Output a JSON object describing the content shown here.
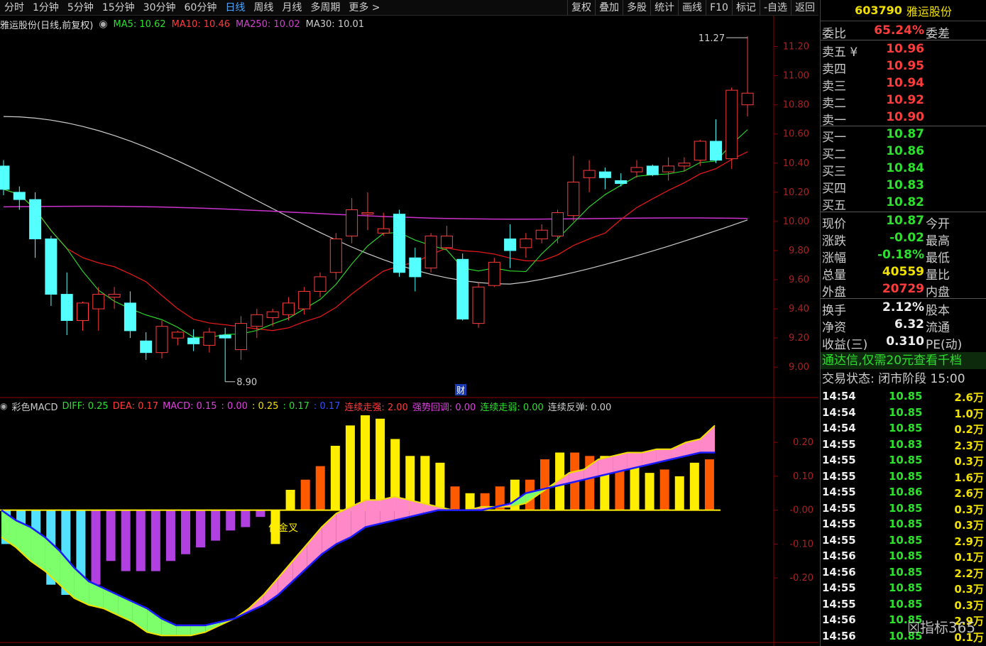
{
  "toolbar": {
    "periods": [
      "分时",
      "1分钟",
      "5分钟",
      "15分钟",
      "30分钟",
      "60分钟",
      "日线",
      "周线",
      "月线",
      "多周期",
      "更多 >"
    ],
    "active_period": "日线",
    "tools": [
      "复权",
      "叠加",
      "多股",
      "统计",
      "画线",
      "F10",
      "标记",
      "-自选",
      "返回"
    ]
  },
  "main_legend": {
    "name": "雅运股份(日线,前复权)",
    "ma5": "MA5: 10.62",
    "ma10": "MA10: 10.46",
    "ma250": "MA250: 10.02",
    "ma30": "MA30: 10.01"
  },
  "macd_legend": {
    "name": "彩色MACD",
    "diff": "DIFF: 0.25",
    "dea": "DEA: 0.17",
    "macd": "MACD: 0.15",
    "v1": ": 0.00",
    "v2": ": 0.25",
    "v3": ": 0.17",
    "v4": ": 0.17",
    "s1": "连续走强: 2.00",
    "s2": "强势回调: 0.00",
    "s3": "连续走弱: 0.00",
    "s4": "连续反弹: 0.00"
  },
  "colors": {
    "up": "#ff3c3c",
    "down": "#54ffff",
    "ma5": "#2ce02c",
    "ma10": "#e01818",
    "ma30": "#cccccc",
    "ma250": "#cc33cc",
    "diff": "#f0e000",
    "dea": "#1a1aff"
  },
  "chart_data": [
    {
      "type": "candlestick",
      "title": "雅运股份(日线,前复权)",
      "ylim": [
        8.85,
        11.3
      ],
      "y_ticks": [
        "11.20",
        "11.00",
        "10.80",
        "10.60",
        "10.40",
        "10.20",
        "10.00",
        "9.80",
        "9.60",
        "9.40",
        "9.20",
        "9.00"
      ],
      "annotations": {
        "high": "11.27",
        "low": "8.90",
        "marker": "财"
      },
      "ohlc": [
        [
          10.38,
          10.42,
          10.18,
          10.22
        ],
        [
          10.2,
          10.24,
          10.08,
          10.15
        ],
        [
          10.15,
          10.2,
          9.75,
          9.88
        ],
        [
          9.88,
          9.9,
          9.42,
          9.5
        ],
        [
          9.5,
          9.65,
          9.22,
          9.32
        ],
        [
          9.32,
          9.45,
          9.25,
          9.44
        ],
        [
          9.4,
          9.55,
          9.25,
          9.5
        ],
        [
          9.48,
          9.55,
          9.4,
          9.5
        ],
        [
          9.44,
          9.52,
          9.2,
          9.25
        ],
        [
          9.18,
          9.24,
          9.05,
          9.1
        ],
        [
          9.1,
          9.32,
          9.06,
          9.28
        ],
        [
          9.2,
          9.25,
          9.15,
          9.24
        ],
        [
          9.2,
          9.26,
          9.11,
          9.16
        ],
        [
          9.15,
          9.27,
          9.1,
          9.24
        ],
        [
          9.22,
          9.27,
          8.9,
          9.2
        ],
        [
          9.12,
          9.35,
          9.05,
          9.3
        ],
        [
          9.28,
          9.4,
          9.2,
          9.36
        ],
        [
          9.34,
          9.4,
          9.28,
          9.38
        ],
        [
          9.36,
          9.48,
          9.32,
          9.44
        ],
        [
          9.4,
          9.55,
          9.36,
          9.52
        ],
        [
          9.52,
          9.65,
          9.48,
          9.62
        ],
        [
          9.65,
          9.92,
          9.6,
          9.88
        ],
        [
          9.9,
          10.16,
          9.85,
          10.08
        ],
        [
          10.05,
          10.2,
          9.94,
          10.06
        ],
        [
          9.92,
          10.06,
          9.9,
          9.95
        ],
        [
          10.05,
          10.08,
          9.62,
          9.65
        ],
        [
          9.75,
          9.82,
          9.52,
          9.62
        ],
        [
          9.68,
          9.92,
          9.65,
          9.9
        ],
        [
          9.82,
          9.97,
          9.8,
          9.9
        ],
        [
          9.74,
          9.78,
          9.32,
          9.33
        ],
        [
          9.3,
          9.58,
          9.27,
          9.55
        ],
        [
          9.56,
          9.75,
          9.55,
          9.72
        ],
        [
          9.88,
          9.98,
          9.68,
          9.8
        ],
        [
          9.82,
          9.92,
          9.75,
          9.88
        ],
        [
          9.88,
          9.98,
          9.85,
          9.94
        ],
        [
          9.9,
          10.08,
          9.85,
          10.06
        ],
        [
          10.04,
          10.45,
          10.0,
          10.27
        ],
        [
          10.3,
          10.42,
          10.2,
          10.35
        ],
        [
          10.34,
          10.37,
          10.22,
          10.3
        ],
        [
          10.28,
          10.33,
          10.24,
          10.26
        ],
        [
          10.34,
          10.42,
          10.3,
          10.37
        ],
        [
          10.38,
          10.39,
          10.31,
          10.32
        ],
        [
          10.34,
          10.44,
          10.28,
          10.38
        ],
        [
          10.38,
          10.44,
          10.34,
          10.4
        ],
        [
          10.42,
          10.56,
          10.38,
          10.55
        ],
        [
          10.55,
          10.7,
          10.4,
          10.42
        ],
        [
          10.43,
          10.92,
          10.36,
          10.9
        ],
        [
          10.8,
          11.27,
          10.72,
          10.88
        ]
      ],
      "ma_end": {
        "ma5": 10.62,
        "ma10": 10.46,
        "ma250": 10.02,
        "ma30": 10.01
      }
    },
    {
      "type": "bar",
      "title": "彩色MACD",
      "y_ticks": [
        "0.20",
        "0.10",
        "-0.00",
        "-0.10",
        "-0.20"
      ],
      "ylim": [
        -0.38,
        0.28
      ],
      "annotations": {
        "signal": "位金叉"
      },
      "macd": [
        -0.1,
        -0.11,
        -0.15,
        -0.22,
        -0.25,
        -0.26,
        -0.22,
        -0.15,
        -0.18,
        -0.18,
        -0.18,
        -0.15,
        -0.13,
        -0.11,
        -0.09,
        -0.06,
        -0.05,
        -0.02,
        -0.1,
        0.06,
        0.09,
        0.13,
        0.19,
        0.25,
        0.28,
        0.27,
        0.21,
        0.16,
        0.16,
        0.14,
        0.07,
        0.05,
        0.05,
        0.07,
        0.09,
        0.09,
        0.15,
        0.17,
        0.17,
        0.16,
        0.16,
        0.14,
        0.13,
        0.11,
        0.12,
        0.1,
        0.14,
        0.15
      ],
      "diff": [
        -0.08,
        -0.11,
        -0.15,
        -0.18,
        -0.22,
        -0.26,
        -0.28,
        -0.29,
        -0.31,
        -0.33,
        -0.36,
        -0.37,
        -0.37,
        -0.37,
        -0.36,
        -0.34,
        -0.32,
        -0.29,
        -0.25,
        -0.2,
        -0.15,
        -0.1,
        -0.05,
        -0.01,
        0.01,
        0.03,
        0.03,
        0.04,
        0.03,
        0.02,
        0.01,
        0.0,
        0.0,
        0.01,
        0.01,
        0.01,
        0.02,
        0.05,
        0.08,
        0.11,
        0.12,
        0.15,
        0.16,
        0.17,
        0.17,
        0.18,
        0.18,
        0.2,
        0.21,
        0.25
      ],
      "dea": [
        -0.0,
        -0.03,
        -0.05,
        -0.08,
        -0.12,
        -0.17,
        -0.21,
        -0.23,
        -0.25,
        -0.27,
        -0.29,
        -0.32,
        -0.34,
        -0.34,
        -0.34,
        -0.33,
        -0.32,
        -0.3,
        -0.28,
        -0.25,
        -0.21,
        -0.17,
        -0.13,
        -0.1,
        -0.08,
        -0.05,
        -0.04,
        -0.03,
        -0.02,
        -0.01,
        0.0,
        -0.0,
        -0.0,
        0.0,
        0.01,
        0.02,
        0.05,
        0.06,
        0.07,
        0.08,
        0.09,
        0.1,
        0.11,
        0.12,
        0.13,
        0.14,
        0.15,
        0.16,
        0.17,
        0.17
      ]
    }
  ],
  "panel": {
    "code": "603790",
    "name": "雅运股份",
    "weibi_label": "委比",
    "weibi_val": "65.24%",
    "weicha_label": "委差",
    "asks": [
      {
        "label": "卖五 ¥",
        "price": "10.96"
      },
      {
        "label": "卖四",
        "price": "10.95"
      },
      {
        "label": "卖三",
        "price": "10.94"
      },
      {
        "label": "卖二",
        "price": "10.92"
      },
      {
        "label": "卖一",
        "price": "10.90"
      }
    ],
    "bids": [
      {
        "label": "买一",
        "price": "10.87"
      },
      {
        "label": "买二",
        "price": "10.86"
      },
      {
        "label": "买三",
        "price": "10.84"
      },
      {
        "label": "买四",
        "price": "10.83"
      },
      {
        "label": "买五",
        "price": "10.82"
      }
    ],
    "stats": [
      {
        "label": "现价",
        "val": "10.87",
        "cls": "green",
        "label2": "今开"
      },
      {
        "label": "涨跌",
        "val": "-0.02",
        "cls": "green",
        "label2": "最高"
      },
      {
        "label": "涨幅",
        "val": "-0.18%",
        "cls": "green",
        "label2": "最低"
      },
      {
        "label": "总量",
        "val": "40559",
        "cls": "yellow",
        "label2": "量比"
      },
      {
        "label": "外盘",
        "val": "20729",
        "cls": "red",
        "label2": "内盘"
      }
    ],
    "stats2": [
      {
        "label": "换手",
        "val": "2.12%",
        "label2": "股本"
      },
      {
        "label": "净资",
        "val": "6.32",
        "label2": "流通"
      },
      {
        "label": "收益(三)",
        "val": "0.310",
        "label2": "PE(动)"
      }
    ],
    "ad": "通达信,仅需20元查看千档",
    "status": "交易状态: 闭市阶段 15:00",
    "ticks": [
      {
        "time": "14:54",
        "price": "10.85",
        "qty": "2.6万"
      },
      {
        "time": "14:54",
        "price": "10.85",
        "qty": "1.0万"
      },
      {
        "time": "14:54",
        "price": "10.85",
        "qty": "0.2万"
      },
      {
        "time": "14:55",
        "price": "10.83",
        "qty": "2.3万"
      },
      {
        "time": "14:55",
        "price": "10.85",
        "qty": "0.3万"
      },
      {
        "time": "14:55",
        "price": "10.85",
        "qty": "1.6万"
      },
      {
        "time": "14:55",
        "price": "10.86",
        "qty": "2.6万"
      },
      {
        "time": "14:55",
        "price": "10.85",
        "qty": "0.3万"
      },
      {
        "time": "14:55",
        "price": "10.85",
        "qty": "0.3万"
      },
      {
        "time": "14:55",
        "price": "10.85",
        "qty": "2.9万"
      },
      {
        "time": "14:56",
        "price": "10.85",
        "qty": "0.1万"
      },
      {
        "time": "14:56",
        "price": "10.85",
        "qty": "2.2万"
      },
      {
        "time": "14:55",
        "price": "10.85",
        "qty": "0.3万"
      },
      {
        "time": "14:55",
        "price": "10.85",
        "qty": "0.3万"
      },
      {
        "time": "14:56",
        "price": "10.85",
        "qty": "2.9万"
      },
      {
        "time": "14:56",
        "price": "10.85",
        "qty": "0.1万"
      }
    ],
    "watermark": "指标365"
  }
}
